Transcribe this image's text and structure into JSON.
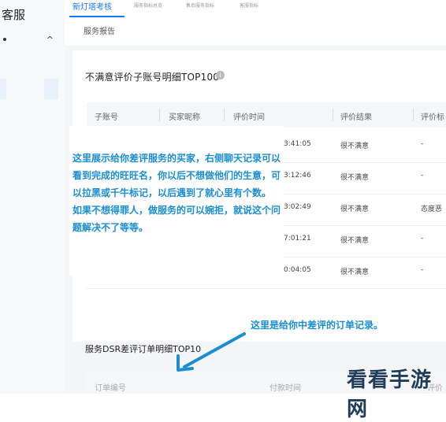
{
  "sidebar": {
    "title": "客服"
  },
  "tabs": {
    "active": "新灯塔考核",
    "tiny_tabs": [
      "服务指标总览",
      "售后服务指标",
      "客服指标"
    ],
    "subtab": "服务报告"
  },
  "section1": {
    "title": "不满意评价子账号明细TOP100",
    "columns": [
      "子账号",
      "买家昵称",
      "评价时间",
      "评价结果",
      "评价标"
    ],
    "rows": [
      {
        "time": "3:41:05",
        "result": "很不满意",
        "tag": "-"
      },
      {
        "time": "3:12:46",
        "result": "很不满意",
        "tag": "-"
      },
      {
        "time": "3:02:49",
        "result": "很不满意",
        "tag": "态度恶"
      },
      {
        "time": "7:01:21",
        "result": "很不满意",
        "tag": "-"
      },
      {
        "time": "0:04:05",
        "result": "很不满意",
        "tag": "-"
      }
    ]
  },
  "annotation1": "这里展示给你差评服务的买家，右侧聊天记录可以看到完成的旺旺名，你以后不想做他们的生意，可以拉黑或千牛标记，以后遇到了就心里有个数。\n如果不想得罪人，做服务的可以婉拒，就说这个问题解决不了等等。",
  "annotation2": "这里是给你中差评的订单记录。",
  "section2": {
    "title": "服务DSR差评订单明细TOP10",
    "columns": [
      "订单编号",
      "付款时间",
      "评价"
    ]
  },
  "watermark": "看看手游网",
  "colors": {
    "accent": "#1677ff",
    "annotation": "#1a8ed1"
  }
}
